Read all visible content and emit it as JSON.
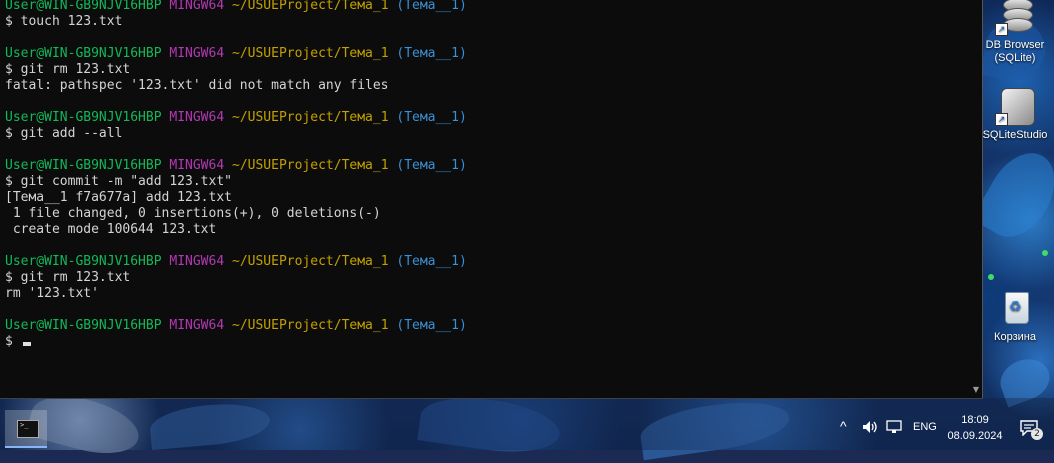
{
  "terminal": {
    "prompt": {
      "user_host": "User@WIN-GB9NJV16HBP",
      "system": "MINGW64",
      "path": "~/USUEProject/Тема_1",
      "branch": "(Тема__1)"
    },
    "lines": [
      {
        "type": "prompt"
      },
      {
        "type": "text",
        "text": "$ touch 123.txt"
      },
      {
        "type": "blank"
      },
      {
        "type": "prompt"
      },
      {
        "type": "text",
        "text": "$ git rm 123.txt"
      },
      {
        "type": "text",
        "text": "fatal: pathspec '123.txt' did not match any files"
      },
      {
        "type": "blank"
      },
      {
        "type": "prompt"
      },
      {
        "type": "text",
        "text": "$ git add --all"
      },
      {
        "type": "blank"
      },
      {
        "type": "prompt"
      },
      {
        "type": "text",
        "text": "$ git commit -m \"add 123.txt\""
      },
      {
        "type": "text",
        "text": "[Тема__1 f7a677a] add 123.txt"
      },
      {
        "type": "text",
        "text": " 1 file changed, 0 insertions(+), 0 deletions(-)"
      },
      {
        "type": "text",
        "text": " create mode 100644 123.txt"
      },
      {
        "type": "blank"
      },
      {
        "type": "prompt"
      },
      {
        "type": "text",
        "text": "$ git rm 123.txt"
      },
      {
        "type": "text",
        "text": "rm '123.txt'"
      },
      {
        "type": "blank"
      },
      {
        "type": "prompt"
      },
      {
        "type": "cursor",
        "text": "$ "
      }
    ]
  },
  "desktop_icons": [
    {
      "label": "DB Browser (SQLite)",
      "icon": "database-icon"
    },
    {
      "label": "SQLiteStudio",
      "icon": "sqlitestudio-icon"
    },
    {
      "label": "Корзина",
      "icon": "recycle-bin-icon"
    }
  ],
  "taskbar": {
    "app_icon": "terminal-icon",
    "terminal_glyph": ">_",
    "tray": {
      "chevron": "^",
      "language": "ENG",
      "time": "18:09",
      "date": "08.09.2024",
      "notifications_count": "2"
    }
  },
  "colors": {
    "user_host": "#12b85a",
    "system": "#b13ab3",
    "path": "#c4a000",
    "branch": "#3a8fd6",
    "terminal_bg": "#0c0c0c"
  }
}
